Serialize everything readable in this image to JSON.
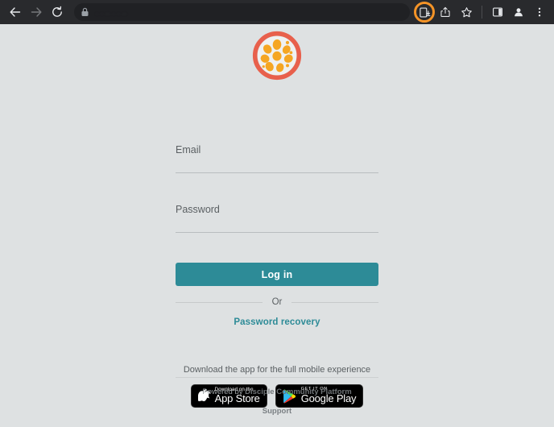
{
  "browser": {
    "back_label": "Back",
    "forward_label": "Forward",
    "reload_label": "Reload",
    "url_text": ". .  ..       .                  .   ..",
    "lock_label": "Connection is secure",
    "actions": [
      {
        "name": "download-icon",
        "label": "Downloads",
        "highlighted": true
      },
      {
        "name": "share-icon",
        "label": "Share",
        "highlighted": false
      },
      {
        "name": "bookmark-star-icon",
        "label": "Bookmark this tab",
        "highlighted": false
      },
      {
        "name": "side-panel-icon",
        "label": "Side panel",
        "highlighted": false
      },
      {
        "name": "profile-avatar-icon",
        "label": "Profile",
        "highlighted": false
      },
      {
        "name": "more-menu-icon",
        "label": "Customize and control",
        "highlighted": false
      }
    ],
    "highlight_color": "#f59427",
    "toolbar_bg": "#292a2d"
  },
  "login": {
    "logo_alt": "Disciple community logo",
    "email": {
      "label": "Email",
      "value": "",
      "placeholder": ""
    },
    "password": {
      "label": "Password",
      "value": "",
      "placeholder": ""
    },
    "submit_label": "Log in",
    "divider_label": "Or",
    "recovery_label": "Password recovery",
    "accent_color": "#2d8b97"
  },
  "app_promo": {
    "text": "Download the app for the full mobile experience",
    "app_store": {
      "small": "Download on the",
      "big": "App Store"
    },
    "google_play": {
      "small": "GET IT ON",
      "big": "Google Play"
    }
  },
  "footer": {
    "powered_prefix": "Powered by ",
    "powered_brand": "Disciple Community Platform",
    "support_label": "Support"
  },
  "theme": {
    "page_bg": "#dee1e2",
    "logo_ring": "#e8604c",
    "logo_seed": "#f5a623"
  }
}
